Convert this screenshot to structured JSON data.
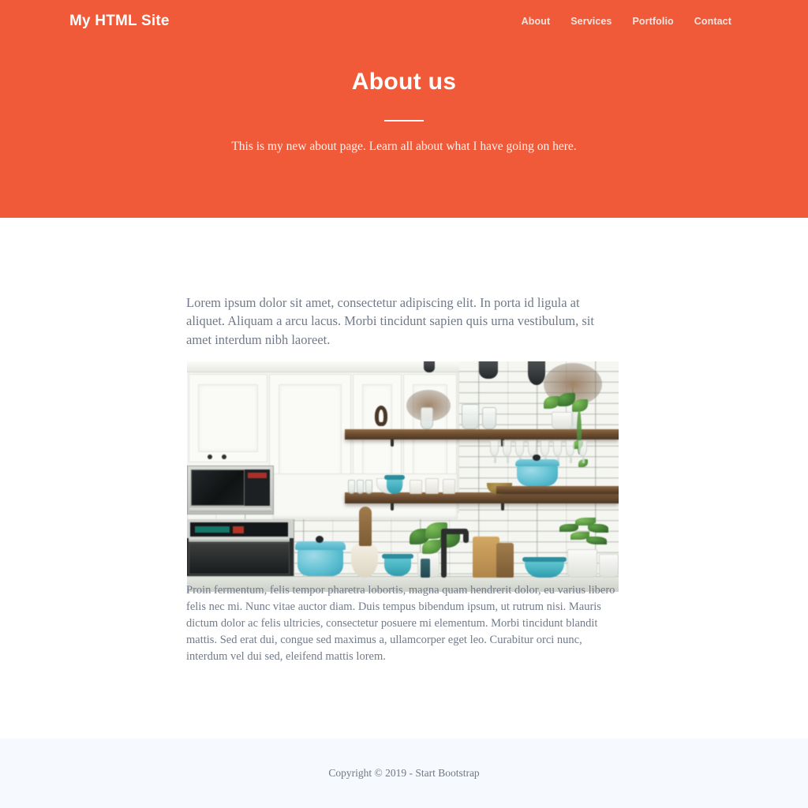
{
  "colors": {
    "accent_orange": "#F15A38",
    "header_text": "#FFFFFF",
    "body_text": "#707A89",
    "footer_bg": "#F6F9FD",
    "page_bg": "#FFFFFF"
  },
  "navbar": {
    "brand": "My HTML Site",
    "links": [
      {
        "label": "About"
      },
      {
        "label": "Services"
      },
      {
        "label": "Portfolio"
      },
      {
        "label": "Contact"
      }
    ]
  },
  "masthead": {
    "heading": "About us",
    "subheading": "This is my new about page. Learn all about what I have going on here."
  },
  "main": {
    "paragraph_one": "Lorem ipsum dolor sit amet, consectetur adipiscing elit. In porta id ligula at aliquet. Aliquam a arcu lacus. Morbi tincidunt sapien quis urna vestibulum, sit amet interdum nibh laoreet.",
    "image_alt": "Modern white kitchen with subway tile backsplash, wooden floating shelves, turquoise dutch ovens and potted plants",
    "paragraph_two": "Proin fermentum, felis tempor pharetra lobortis, magna quam hendrerit dolor, eu varius libero felis nec mi. Nunc vitae auctor diam. Duis tempus bibendum ipsum, ut rutrum nisi. Mauris dictum dolor ac felis ultricies, consectetur posuere mi elementum. Morbi tincidunt blandit mattis. Sed erat dui, congue sed maximus a, ullamcorper eget leo. Curabitur orci nunc, interdum vel dui sed, eleifend mattis lorem."
  },
  "footer": {
    "copyright": "Copyright © 2019 - Start Bootstrap"
  }
}
